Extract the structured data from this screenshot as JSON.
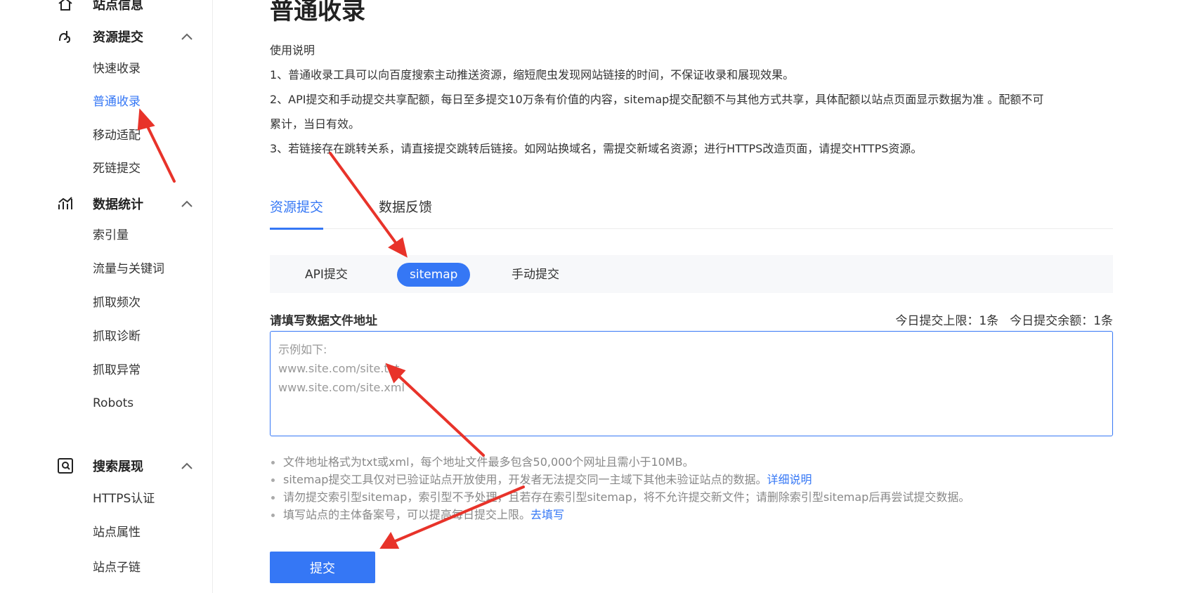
{
  "sidebar": {
    "top_item": {
      "label": "站点信息",
      "icon": "home-icon"
    },
    "sections": [
      {
        "label": "资源提交",
        "icon": "resource-submit-icon",
        "items": [
          "快速收录",
          "普通收录",
          "移动适配",
          "死链提交"
        ],
        "active_item": "普通收录"
      },
      {
        "label": "数据统计",
        "icon": "stats-chart-icon",
        "items": [
          "索引量",
          "流量与关键词",
          "抓取频次",
          "抓取诊断",
          "抓取异常",
          "Robots"
        ]
      },
      {
        "label": "搜索展现",
        "icon": "search-display-icon",
        "items": [
          "HTTPS认证",
          "站点属性",
          "站点子链"
        ]
      }
    ]
  },
  "main": {
    "title": "普通收录",
    "instructions": {
      "heading": "使用说明",
      "line1": "1、普通收录工具可以向百度搜索主动推送资源，缩短爬虫发现网站链接的时间，不保证收录和展现效果。",
      "line2a": "2、API提交和手动提交共享配额，每日至多提交10万条有价值的内容，sitemap提交配额不与其他方式共享，具体配额以站点页面显示数据为准 。配额不可",
      "line2b": "累计，当日有效。",
      "line3": "3、若链接存在跳转关系，请直接提交跳转后链接。如网站换域名，需提交新域名资源；进行HTTPS改造页面，请提交HTTPS资源。"
    },
    "tabs": [
      "资源提交",
      "数据反馈"
    ],
    "active_tab": "资源提交",
    "methods": [
      "API提交",
      "sitemap",
      "手动提交"
    ],
    "active_method": "sitemap",
    "field_label": "请填写数据文件地址",
    "quota_limit": "今日提交上限：1条",
    "quota_remaining": "今日提交余额：1条",
    "placeholder": {
      "line1": "示例如下:",
      "line2": "www.site.com/site.txt",
      "line3": "www.site.com/site.xml"
    },
    "notes": {
      "n1": "文件地址格式为txt或xml，每个地址文件最多包含50,000个网址且需小于10MB。",
      "n2": "sitemap提交工具仅对已验证站点开放使用，开发者无法提交同一主域下其他未验证站点的数据。",
      "n2_link": "详细说明",
      "n3": "请勿提交索引型sitemap，索引型不予处理，且若存在索引型sitemap，将不允许提交新文件；请删除索引型sitemap后再尝试提交数据。",
      "n4": "填写站点的主体备案号，可以提高每日提交上限。",
      "n4_link": "去填写"
    },
    "submit_label": "提交"
  },
  "annotation_color": "#e8332a",
  "accent_color": "#3577f5"
}
